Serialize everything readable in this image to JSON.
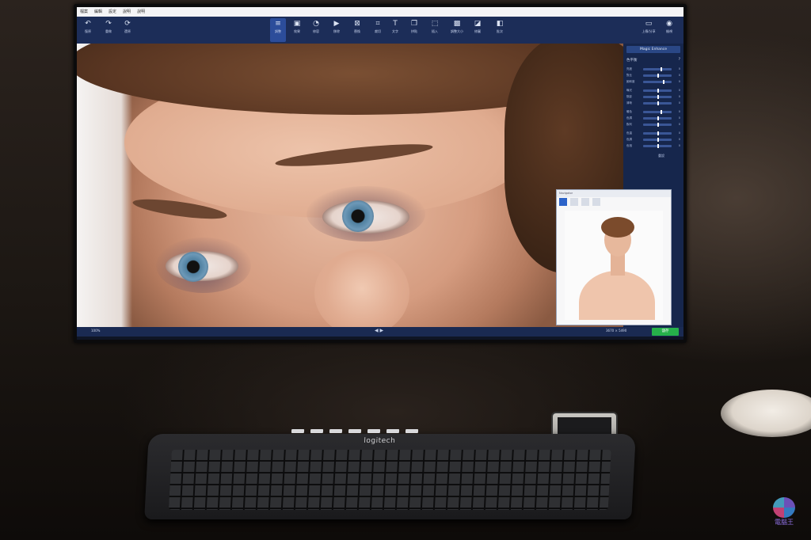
{
  "app": {
    "menu": [
      "檔案",
      "編輯",
      "設定",
      "說明",
      "說明"
    ],
    "toolbar": [
      {
        "icon": "undo-icon",
        "label": "復原"
      },
      {
        "icon": "redo-icon",
        "label": "重做"
      },
      {
        "icon": "reset-icon",
        "label": "還原"
      },
      {
        "icon": "adjust-icon",
        "label": "調整"
      },
      {
        "icon": "camera-icon",
        "label": "效果"
      },
      {
        "icon": "retouch-icon",
        "label": "修容"
      },
      {
        "icon": "remove-icon",
        "label": "移除"
      },
      {
        "icon": "replace-icon",
        "label": "替換"
      },
      {
        "icon": "crop-icon",
        "label": "裁切"
      },
      {
        "icon": "text-icon",
        "label": "文字"
      },
      {
        "icon": "copy-icon",
        "label": "拼貼"
      },
      {
        "icon": "insert-icon",
        "label": "插入"
      },
      {
        "icon": "resize-icon",
        "label": "調整大小"
      },
      {
        "icon": "retouch-tool-icon",
        "label": "修圖"
      },
      {
        "icon": "compare-icon",
        "label": "批次"
      }
    ],
    "right_tool": {
      "label": "上傳/分享"
    },
    "view_tool": {
      "label": "檢視"
    }
  },
  "panel": {
    "header": "Magic Enhance",
    "section": "色平衡",
    "sliders": [
      {
        "name": "亮度",
        "value": 0.6
      },
      {
        "name": "對比",
        "value": 0.5
      },
      {
        "name": "飽和度",
        "value": 0.7
      },
      {
        "name": "曝光",
        "value": 0.5
      },
      {
        "name": "陰影",
        "value": 0.5
      },
      {
        "name": "清晰",
        "value": 0.5
      },
      {
        "name": "暖色",
        "value": 0.6
      },
      {
        "name": "色調",
        "value": 0.5
      },
      {
        "name": "銳利",
        "value": 0.5
      },
      {
        "name": "色溫",
        "value": 0.5
      },
      {
        "name": "色調",
        "value": 0.5
      },
      {
        "name": "色相",
        "value": 0.5
      }
    ],
    "reset": "重設"
  },
  "thumbnail": {
    "title": "Navigator"
  },
  "status": {
    "zoom": "100%",
    "dimensions": "3670 × 5490",
    "save": "儲存"
  },
  "keyboard": {
    "brand": "logitech"
  },
  "watermark": {
    "text": "電腦王"
  }
}
